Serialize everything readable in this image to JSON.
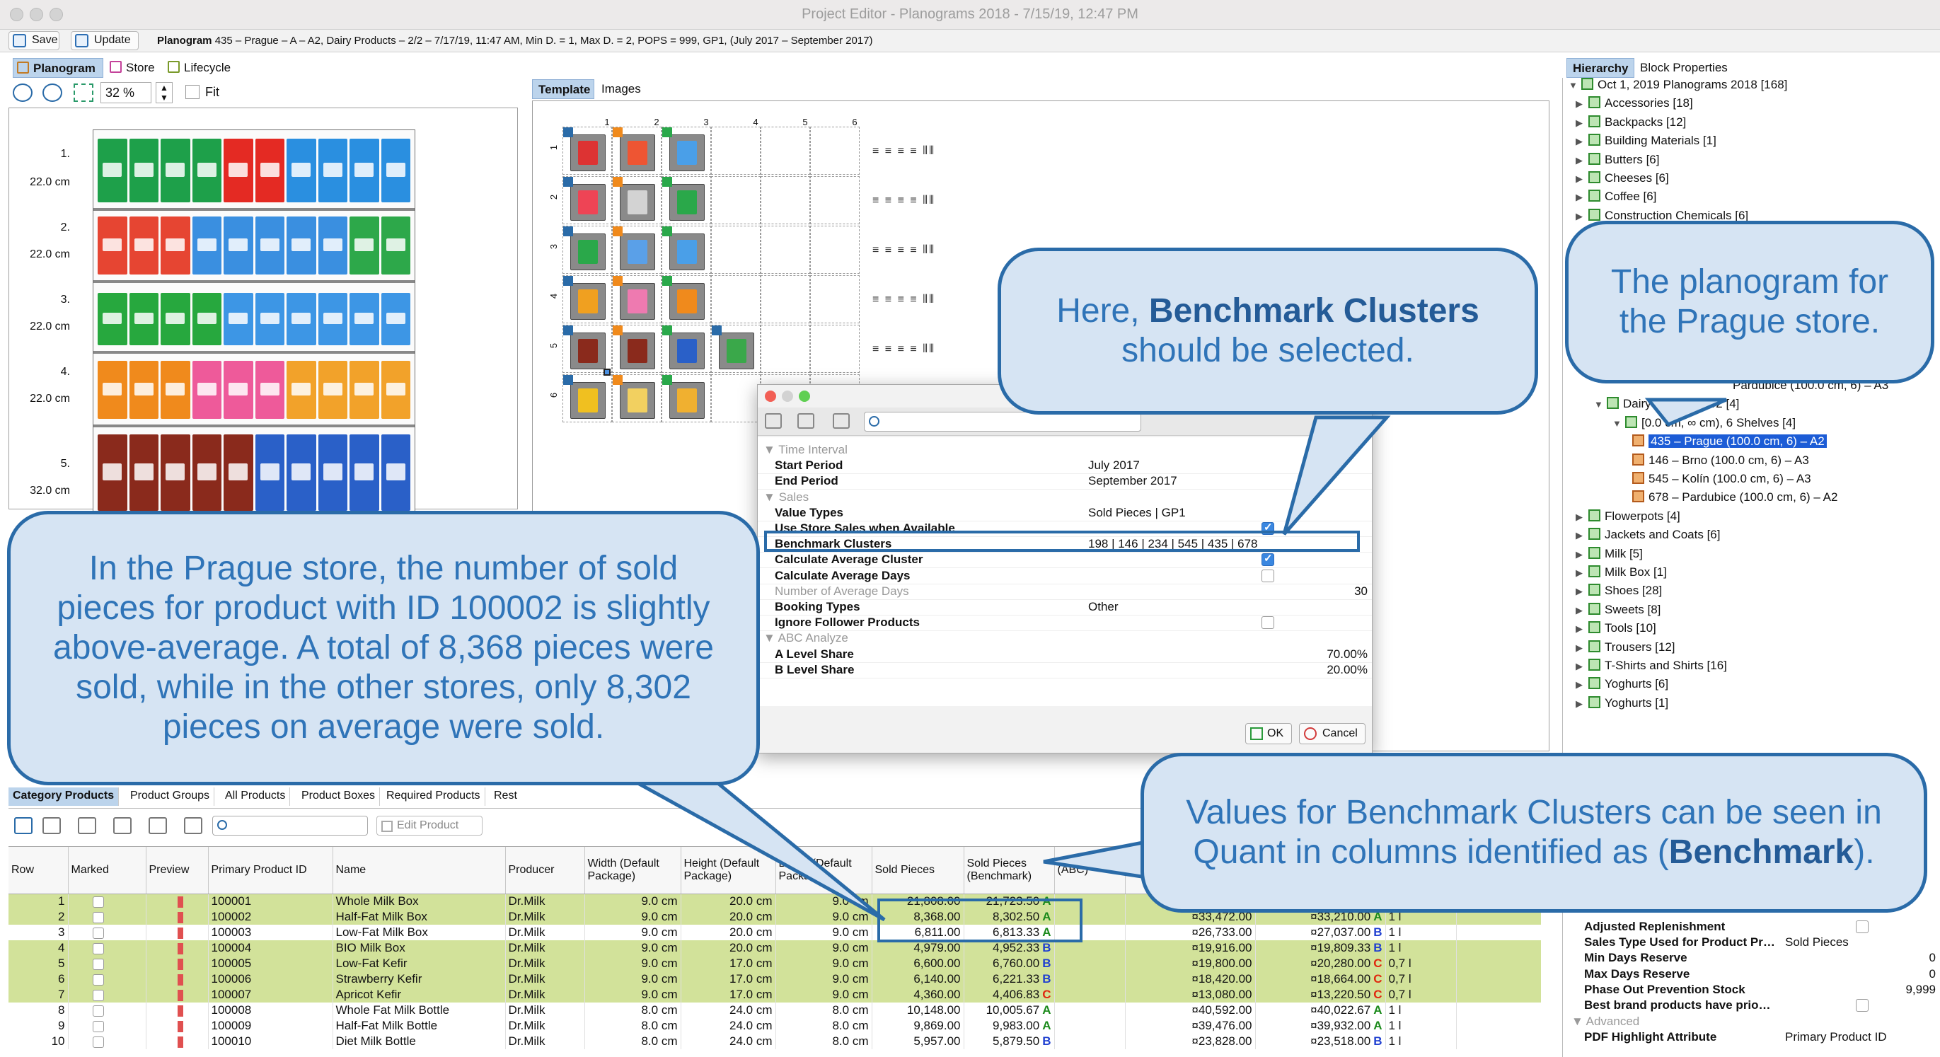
{
  "window": {
    "title": "Project Editor - Planograms 2018 - 7/15/19, 12:47 PM"
  },
  "toolbar": {
    "save": "Save",
    "update": "Update",
    "planogram_label": "Planogram",
    "planogram_info": "435 – Prague – A – A2, Dairy Products – 2/2 – 7/17/19, 11:47 AM, Min D. = 1, Max D. = 2, POPS = 999, GP1, (July 2017 – September 2017)"
  },
  "left": {
    "tabs": [
      "Planogram",
      "Store",
      "Lifecycle"
    ],
    "zoom": "32 %",
    "fit": "Fit",
    "shelves": [
      {
        "num": "1.",
        "height": "22.0 cm"
      },
      {
        "num": "2.",
        "height": "22.0 cm"
      },
      {
        "num": "3.",
        "height": "22.0 cm"
      },
      {
        "num": "4.",
        "height": "22.0 cm"
      },
      {
        "num": "5.",
        "height": "32.0 cm"
      }
    ]
  },
  "template": {
    "tabs": [
      "Template",
      "Images"
    ],
    "cols": [
      "1",
      "2",
      "3",
      "4",
      "5",
      "6"
    ],
    "rows": [
      "1",
      "2",
      "3",
      "4",
      "5",
      "6"
    ]
  },
  "dialog": {
    "sections": {
      "time": "Time Interval",
      "sales": "Sales",
      "abc": "ABC Analyze"
    },
    "props": {
      "start_period": "Start Period",
      "end_period": "End Period",
      "value_types": "Value Types",
      "use_store": "Use Store Sales when Available",
      "benchmark": "Benchmark Clusters",
      "calc_avg_cluster": "Calculate Average Cluster",
      "calc_avg_days": "Calculate Average Days",
      "num_avg_days": "Number of Average Days",
      "booking": "Booking Types",
      "ignore_follower": "Ignore Follower Products",
      "a_share": "A Level Share",
      "b_share": "B Level Share"
    },
    "values": {
      "start_period": "July 2017",
      "end_period": "September 2017",
      "value_types": "Sold Pieces | GP1",
      "benchmark": "198 | 146 | 234 | 545 | 435 | 678",
      "num_avg_days": "30",
      "booking": "Other",
      "a_share": "70.00%",
      "b_share": "20.00%"
    },
    "ok": "OK",
    "cancel": "Cancel"
  },
  "hierarchy": {
    "tabs": [
      "Hierarchy",
      "Block Properties"
    ],
    "root": "Oct 1, 2019 Planograms 2018 [168]",
    "items_top": [
      "Accessories [18]",
      "Backpacks [12]",
      "Building Materials [1]",
      "Butters [6]",
      "Cheeses [6]",
      "Coffee [6]",
      "Construction Chemicals [6]"
    ],
    "partial_top": "Pardubice  (100.0 cm, 6) – A3",
    "dairy": "Dairy P……s – 2/2 [4]",
    "shelves_node": "[0.0 cm, ∞ cm), 6 Shelves [4]",
    "stores": [
      "435 – Prague (100.0 cm, 6) – A2",
      "146 – Brno (100.0 cm, 6) – A3",
      "545 – Kolín (100.0 cm, 6) – A3",
      "678 – Pardubice  (100.0 cm, 6) – A2"
    ],
    "items_bottom": [
      "Flowerpots [4]",
      "Jackets and Coats [6]",
      "Milk [5]",
      "Milk Box [1]",
      "Shoes [28]",
      "Sweets [8]",
      "Tools [10]",
      "Trousers [12]",
      "T-Shirts and Shirts [16]",
      "Yoghurts [6]",
      "Yoghurts [1]"
    ]
  },
  "bottom": {
    "tabs": [
      "Category Products",
      "Product Groups",
      "All Products",
      "Product Boxes",
      "Required Products",
      "Rest"
    ],
    "edit_product": "Edit Product",
    "headers": [
      "Row",
      "Marked",
      "Preview",
      "Primary Product ID",
      "Name",
      "Producer",
      "Width (Default Package)",
      "Height (Default Package)",
      "Depth (Default Package)",
      "Sold Pieces",
      "Sold Pieces (Benchmark)",
      "(ABC)"
    ],
    "rows": [
      [
        "1",
        "100001",
        "Whole Milk Box",
        "Dr.Milk",
        "9.0 cm",
        "20.0 cm",
        "9.0 cm",
        "21,808.00",
        "21,723.50",
        "A",
        "",
        "",
        "",
        ""
      ],
      [
        "2",
        "100002",
        "Half-Fat Milk Box",
        "Dr.Milk",
        "9.0 cm",
        "20.0 cm",
        "9.0 cm",
        "8,368.00",
        "8,302.50",
        "A",
        "¤33,472.00",
        "¤33,210.00",
        "A",
        "1 l"
      ],
      [
        "3",
        "100003",
        "Low-Fat Milk Box",
        "Dr.Milk",
        "9.0 cm",
        "20.0 cm",
        "9.0 cm",
        "6,811.00",
        "6,813.33",
        "A",
        "¤26,733.00",
        "¤27,037.00",
        "B",
        "1 l"
      ],
      [
        "4",
        "100004",
        "BIO Milk Box",
        "Dr.Milk",
        "9.0 cm",
        "20.0 cm",
        "9.0 cm",
        "4,979.00",
        "4,952.33",
        "B",
        "¤19,916.00",
        "¤19,809.33",
        "B",
        "1 l"
      ],
      [
        "5",
        "100005",
        "Low-Fat Kefir",
        "Dr.Milk",
        "9.0 cm",
        "17.0 cm",
        "9.0 cm",
        "6,600.00",
        "6,760.00",
        "B",
        "¤19,800.00",
        "¤20,280.00",
        "C",
        "0,7 l"
      ],
      [
        "6",
        "100006",
        "Strawberry Kefir",
        "Dr.Milk",
        "9.0 cm",
        "17.0 cm",
        "9.0 cm",
        "6,140.00",
        "6,221.33",
        "B",
        "¤18,420.00",
        "¤18,664.00",
        "C",
        "0,7 l"
      ],
      [
        "7",
        "100007",
        "Apricot Kefir",
        "Dr.Milk",
        "9.0 cm",
        "17.0 cm",
        "9.0 cm",
        "4,360.00",
        "4,406.83",
        "C",
        "¤13,080.00",
        "¤13,220.50",
        "C",
        "0,7 l"
      ],
      [
        "8",
        "100008",
        "Whole Fat Milk Bottle",
        "Dr.Milk",
        "8.0 cm",
        "24.0 cm",
        "8.0 cm",
        "10,148.00",
        "10,005.67",
        "A",
        "¤40,592.00",
        "¤40,022.67",
        "A",
        "1 l"
      ],
      [
        "9",
        "100009",
        "Half-Fat Milk Bottle",
        "Dr.Milk",
        "8.0 cm",
        "24.0 cm",
        "8.0 cm",
        "9,869.00",
        "9,983.00",
        "A",
        "¤39,476.00",
        "¤39,932.00",
        "A",
        "1 l"
      ],
      [
        "10",
        "100010",
        "Diet Milk Bottle",
        "Dr.Milk",
        "8.0 cm",
        "24.0 cm",
        "8.0 cm",
        "5,957.00",
        "5,879.50",
        "B",
        "¤23,828.00",
        "¤23,518.00",
        "B",
        "1 l"
      ]
    ]
  },
  "right_props": {
    "rows": [
      [
        "Adjusted Replenishment",
        ""
      ],
      [
        "Sales Type Used for Product Pr…",
        "Sold Pieces"
      ],
      [
        "Min Days Reserve",
        "0"
      ],
      [
        "Max Days Reserve",
        "0"
      ],
      [
        "Phase Out Prevention Stock",
        "9,999"
      ],
      [
        "Best brand products have prio…",
        ""
      ]
    ],
    "advanced": "Advanced",
    "pdf_label": "PDF Highlight Attribute",
    "pdf_value": "Primary Product ID"
  },
  "callouts": {
    "c1": "Here, Benchmark Clusters should be selected.",
    "c1_pre": "Here, ",
    "c1_bold": "Benchmark Clusters",
    "c1_post": "should be selected.",
    "c2": "The planogram for the Prague store.",
    "c3": "In the Prague store, the number of sold pieces for product with ID 100002 is slightly above-average. A total of 8,368 pieces were sold, while in the other stores, only 8,302 pieces on average were sold.",
    "c4_pre": "Values for Benchmark Clusters can be seen in Quant in columns identified as (",
    "c4_bold": "Benchmark",
    "c4_post": ")."
  },
  "colors": {
    "accent": "#2a6ba8",
    "callout_bg": "#d6e4f3",
    "row_green": "#d2e29a",
    "selection": "#1c5cd6"
  }
}
